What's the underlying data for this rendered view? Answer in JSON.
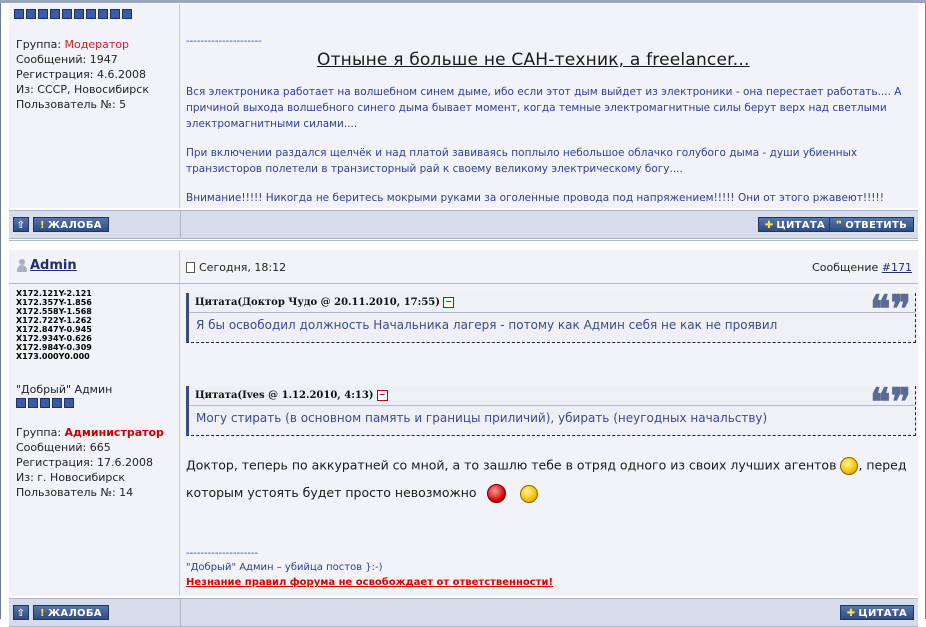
{
  "post1": {
    "user": {
      "group_label": "Группа:",
      "group_value": "Модератор",
      "posts": "Сообщений: 1947",
      "registered": "Регистрация: 4.6.2008",
      "from": "Из: СССР, Новосибирск",
      "user_no": "Пользователь №: 5"
    },
    "signature": {
      "dashes": "---------------------",
      "title": "Отныне я больше не САН-техник, а freelancer...",
      "para1": "Вся электроника работает на волшебном синем дыме, ибо если этот дым выйдет из электроники - она перестает работать.... А причиной выхода волшебного синего дыма бывает момент, когда темные электромагнитные силы берут верх над светлыми электромагнитными силами....",
      "para2": "При включении раздался щелчёк и над платой завиваясь поплыло небольшое облачко голубого дыма - души убиенных транзисторов полетели в транзисторный рай к своему великому электрическому богу....",
      "para3": "Внимание!!!!! Никогда не беритесь мокрыми руками за оголенные провода под напряжением!!!!! Они от этого ржавеют!!!!!"
    }
  },
  "bar1": {
    "complaint": "ЖАЛОБА",
    "quote": "ЦИТАТА",
    "reply": "ОТВЕТИТЬ"
  },
  "post2": {
    "user": {
      "name": "Admin",
      "coords": [
        "X172.121Y-2.121",
        "X172.357Y-1.856",
        "X172.558Y-1.568",
        "X172.722Y-1.262",
        "X172.847Y-0.945",
        "X172.934Y-0.626",
        "X172.984Y-0.309",
        "X173.000Y0.000"
      ],
      "title": "\"Добрый\" Админ",
      "group_label": "Группа:",
      "group_value": "Администратор",
      "posts": "Сообщений: 665",
      "registered": "Регистрация: 17.6.2008",
      "from": "Из: г. Новосибирск",
      "user_no": "Пользователь №: 14"
    },
    "date": "Сегодня, 18:12",
    "msg_label": "Сообщение",
    "msg_num": "#171",
    "quote1": {
      "head": "Цитата(Доктор Чудо @ 20.11.2010, 17:55)",
      "body": "Я бы освободил должность Начальника лагеря - потому как Админ себя не как не проявил"
    },
    "quote2": {
      "head": "Цитата(Ives @ 1.12.2010, 4:13)",
      "body": "Могу стирать (в основном память и границы приличий), убирать (неугодных начальству)"
    },
    "text1": "Доктор, теперь по аккуратней со мной, а то зашлю тебе в отряд одного из своих лучших агентов",
    "text2": ", перед",
    "text3": "которым устоять будет просто невозможно",
    "sig_dashes": "--------------------",
    "sig_line": "\"Добрый\" Админ – убийца постов }:-)",
    "sig_rule": "Незнание правил форума не освобождает от ответственности!"
  },
  "bar2": {
    "complaint": "ЖАЛОБА",
    "quote": "ЦИТАТА"
  },
  "colors": {
    "accent": "#2f4c80",
    "moderator": "#cc2222",
    "admin": "#cc0000",
    "signature_text": "#2e3f93"
  }
}
